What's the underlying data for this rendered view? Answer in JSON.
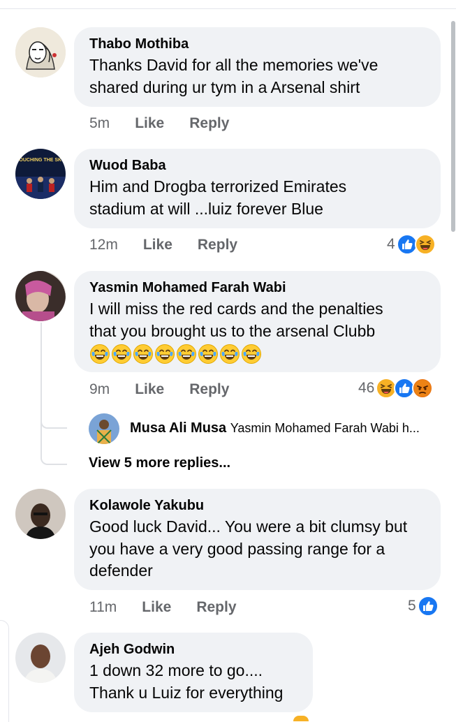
{
  "comments": [
    {
      "author": "Thabo Mothiba",
      "lines": [
        "Thanks David for all the memories we've",
        "shared during ur tym in a Arsenal shirt"
      ],
      "time": "5m",
      "like": "Like",
      "reply": "Reply"
    },
    {
      "author": "Wuod Baba",
      "lines": [
        "Him and Drogba terrorized Emirates",
        "stadium at will ...luiz forever Blue"
      ],
      "time": "12m",
      "like": "Like",
      "reply": "Reply",
      "reaction_count": "4"
    },
    {
      "author": "Yasmin Mohamed Farah Wabi",
      "lines": [
        "I will miss the red cards and the penalties",
        "that you brought us to the arsenal Clubb"
      ],
      "time": "9m",
      "like": "Like",
      "reply": "Reply",
      "reaction_count": "46"
    },
    {
      "author": "Kolawole Yakubu",
      "lines": [
        "Good luck David... You were a bit clumsy but",
        "you have a very good passing range for a",
        "defender"
      ],
      "time": "11m",
      "like": "Like",
      "reply": "Reply",
      "reaction_count": "5"
    },
    {
      "author": "Ajeh Godwin",
      "lines": [
        "1 down 32 more to go....",
        "Thank u Luiz for everything"
      ]
    }
  ],
  "avatar_text": {
    "wuod": "TOUCHING THE SKY"
  },
  "reply_preview": {
    "author": "Musa Ali Musa",
    "text": "Yasmin Mohamed Farah Wabi h..."
  },
  "view_more": "View 5 more replies...",
  "reaction_icons": [
    "like-icon",
    "haha-icon",
    "angry-icon"
  ],
  "colors": {
    "bubble": "#f0f2f5",
    "secondary_text": "#65676b",
    "like_blue": "#1877f2",
    "haha_yellow": "#f7b125",
    "angry_red": "#e9710f"
  }
}
